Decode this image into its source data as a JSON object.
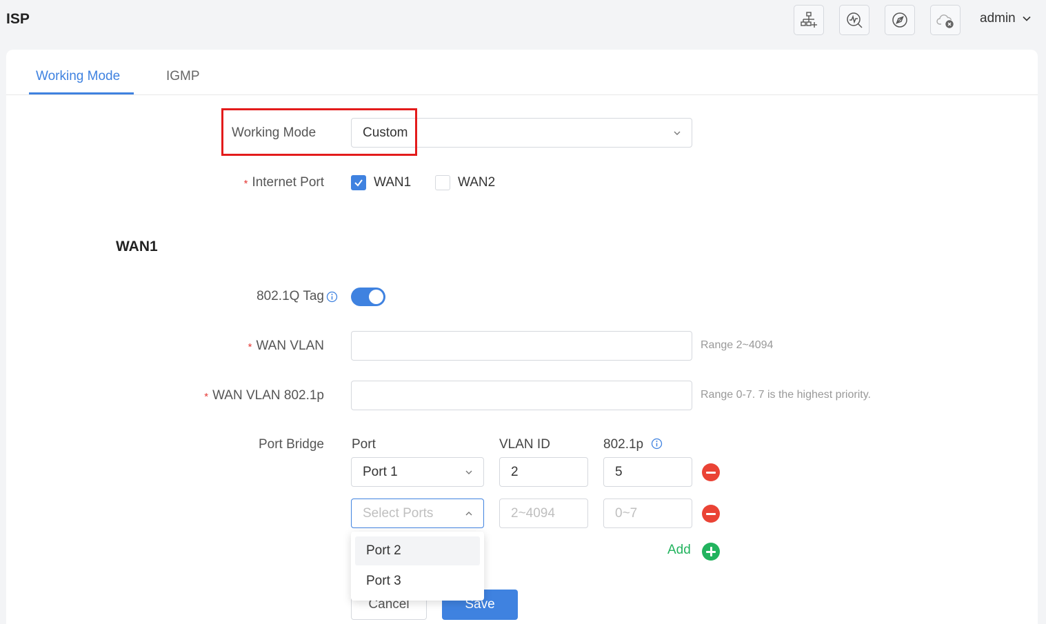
{
  "header": {
    "title": "ISP",
    "icons": [
      "network-add-icon",
      "diagnostics-icon",
      "compass-icon",
      "cloud-offline-icon"
    ],
    "user": "admin"
  },
  "tabs": [
    {
      "label": "Working Mode",
      "active": true
    },
    {
      "label": "IGMP",
      "active": false
    }
  ],
  "form": {
    "working_mode": {
      "label": "Working Mode",
      "value": "Custom"
    },
    "internet_port": {
      "label": "Internet Port",
      "required_mark": "*",
      "options": [
        {
          "label": "WAN1",
          "checked": true
        },
        {
          "label": "WAN2",
          "checked": false
        }
      ]
    }
  },
  "wan1": {
    "section_title": "WAN1",
    "tag_label": "802.1Q Tag",
    "tag_enabled": true,
    "wan_vlan": {
      "label": "WAN VLAN",
      "value": "",
      "hint": "Range 2~4094"
    },
    "wan_vlan_p": {
      "label": "WAN VLAN 802.1p",
      "value": "",
      "hint": "Range 0-7. 7 is the highest priority."
    },
    "port_bridge": {
      "label": "Port Bridge",
      "columns": {
        "port": "Port",
        "vlan_id": "VLAN ID",
        "p": "802.1p"
      },
      "rows": [
        {
          "port": "Port 1",
          "vlan_id": "2",
          "p": "5"
        }
      ],
      "new_row": {
        "port_placeholder": "Select Ports",
        "vlan_placeholder": "2~4094",
        "p_placeholder": "0~7"
      },
      "add_label": "Add",
      "dropdown_options": [
        "Port 2",
        "Port 3"
      ]
    }
  },
  "actions": {
    "cancel": "Cancel",
    "save": "Save"
  },
  "colors": {
    "accent": "#3f82e0",
    "danger": "#ea4335",
    "success": "#22b35e",
    "highlight": "#e31b1b"
  }
}
